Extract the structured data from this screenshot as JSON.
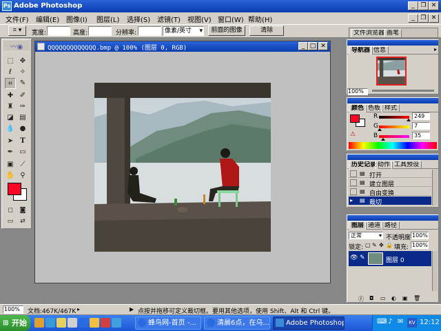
{
  "app": {
    "title": "Adobe Photoshop",
    "icon_text": "Ps"
  },
  "window_controls": {
    "minimize": "_",
    "restore": "❐",
    "close": "✕"
  },
  "menus": [
    "文件(F)",
    "编辑(E)",
    "图像(I)",
    "图层(L)",
    "选择(S)",
    "滤镜(T)",
    "视图(V)",
    "窗口(W)",
    "帮助(H)"
  ],
  "options_bar": {
    "width_label": "宽度:",
    "height_label": "高度:",
    "resolution_label": "分辨率:",
    "unit_select": "像素/英寸",
    "front_image_button": "前面的图像",
    "clear_button": "清除",
    "file_browser_tab": "文件浏览器",
    "brushes_tab": "画笔"
  },
  "document": {
    "title": "QQQQQQQQQQQQQ.bmp @ 100% (图层 0, RGB)",
    "zoom": "100%",
    "doc_info": "文档:467K/467K",
    "status_hint": "点按并拖移可定义裁切框。要用其他选项，使用 Shift、Alt 和 Ctrl 键。"
  },
  "navigator": {
    "tabs": [
      "导航器",
      "信息"
    ],
    "zoom": "100%"
  },
  "color_panel": {
    "tabs": [
      "颜色",
      "色板",
      "样式"
    ],
    "r_label": "R",
    "g_label": "G",
    "b_label": "B",
    "r_value": "249",
    "g_value": "7",
    "b_value": "35",
    "r_fraction": 0.976,
    "g_fraction": 0.027,
    "b_fraction": 0.137,
    "foreground_color": "#f90723"
  },
  "history_panel": {
    "tabs": [
      "历史记录",
      "动作",
      "工具预设"
    ],
    "items": [
      "打开",
      "建立图层",
      "自由变换",
      "裁切"
    ],
    "selected_index": 3
  },
  "layers_panel": {
    "tabs": [
      "图层",
      "通道",
      "路径"
    ],
    "blend_mode": "正常",
    "opacity_label": "不透明度:",
    "opacity_value": "100%",
    "lock_label": "锁定:",
    "fill_label": "填充:",
    "fill_value": "100%",
    "layers": [
      {
        "name": "图层 0",
        "visible": true
      }
    ]
  },
  "taskbar": {
    "start": "开始",
    "tasks": [
      "蜂鸟网-首页 -...",
      "清晨6点，在乌...",
      "Adobe Photoshop"
    ],
    "active_task_index": 2,
    "clock": "12:12",
    "tray_ime": "KV"
  },
  "colors": {
    "title_blue": "#0a3cb0",
    "panel_gray": "#d4d0c8",
    "workspace_gray": "#878787",
    "foreground": "#f90723",
    "background": "#ffffff"
  }
}
